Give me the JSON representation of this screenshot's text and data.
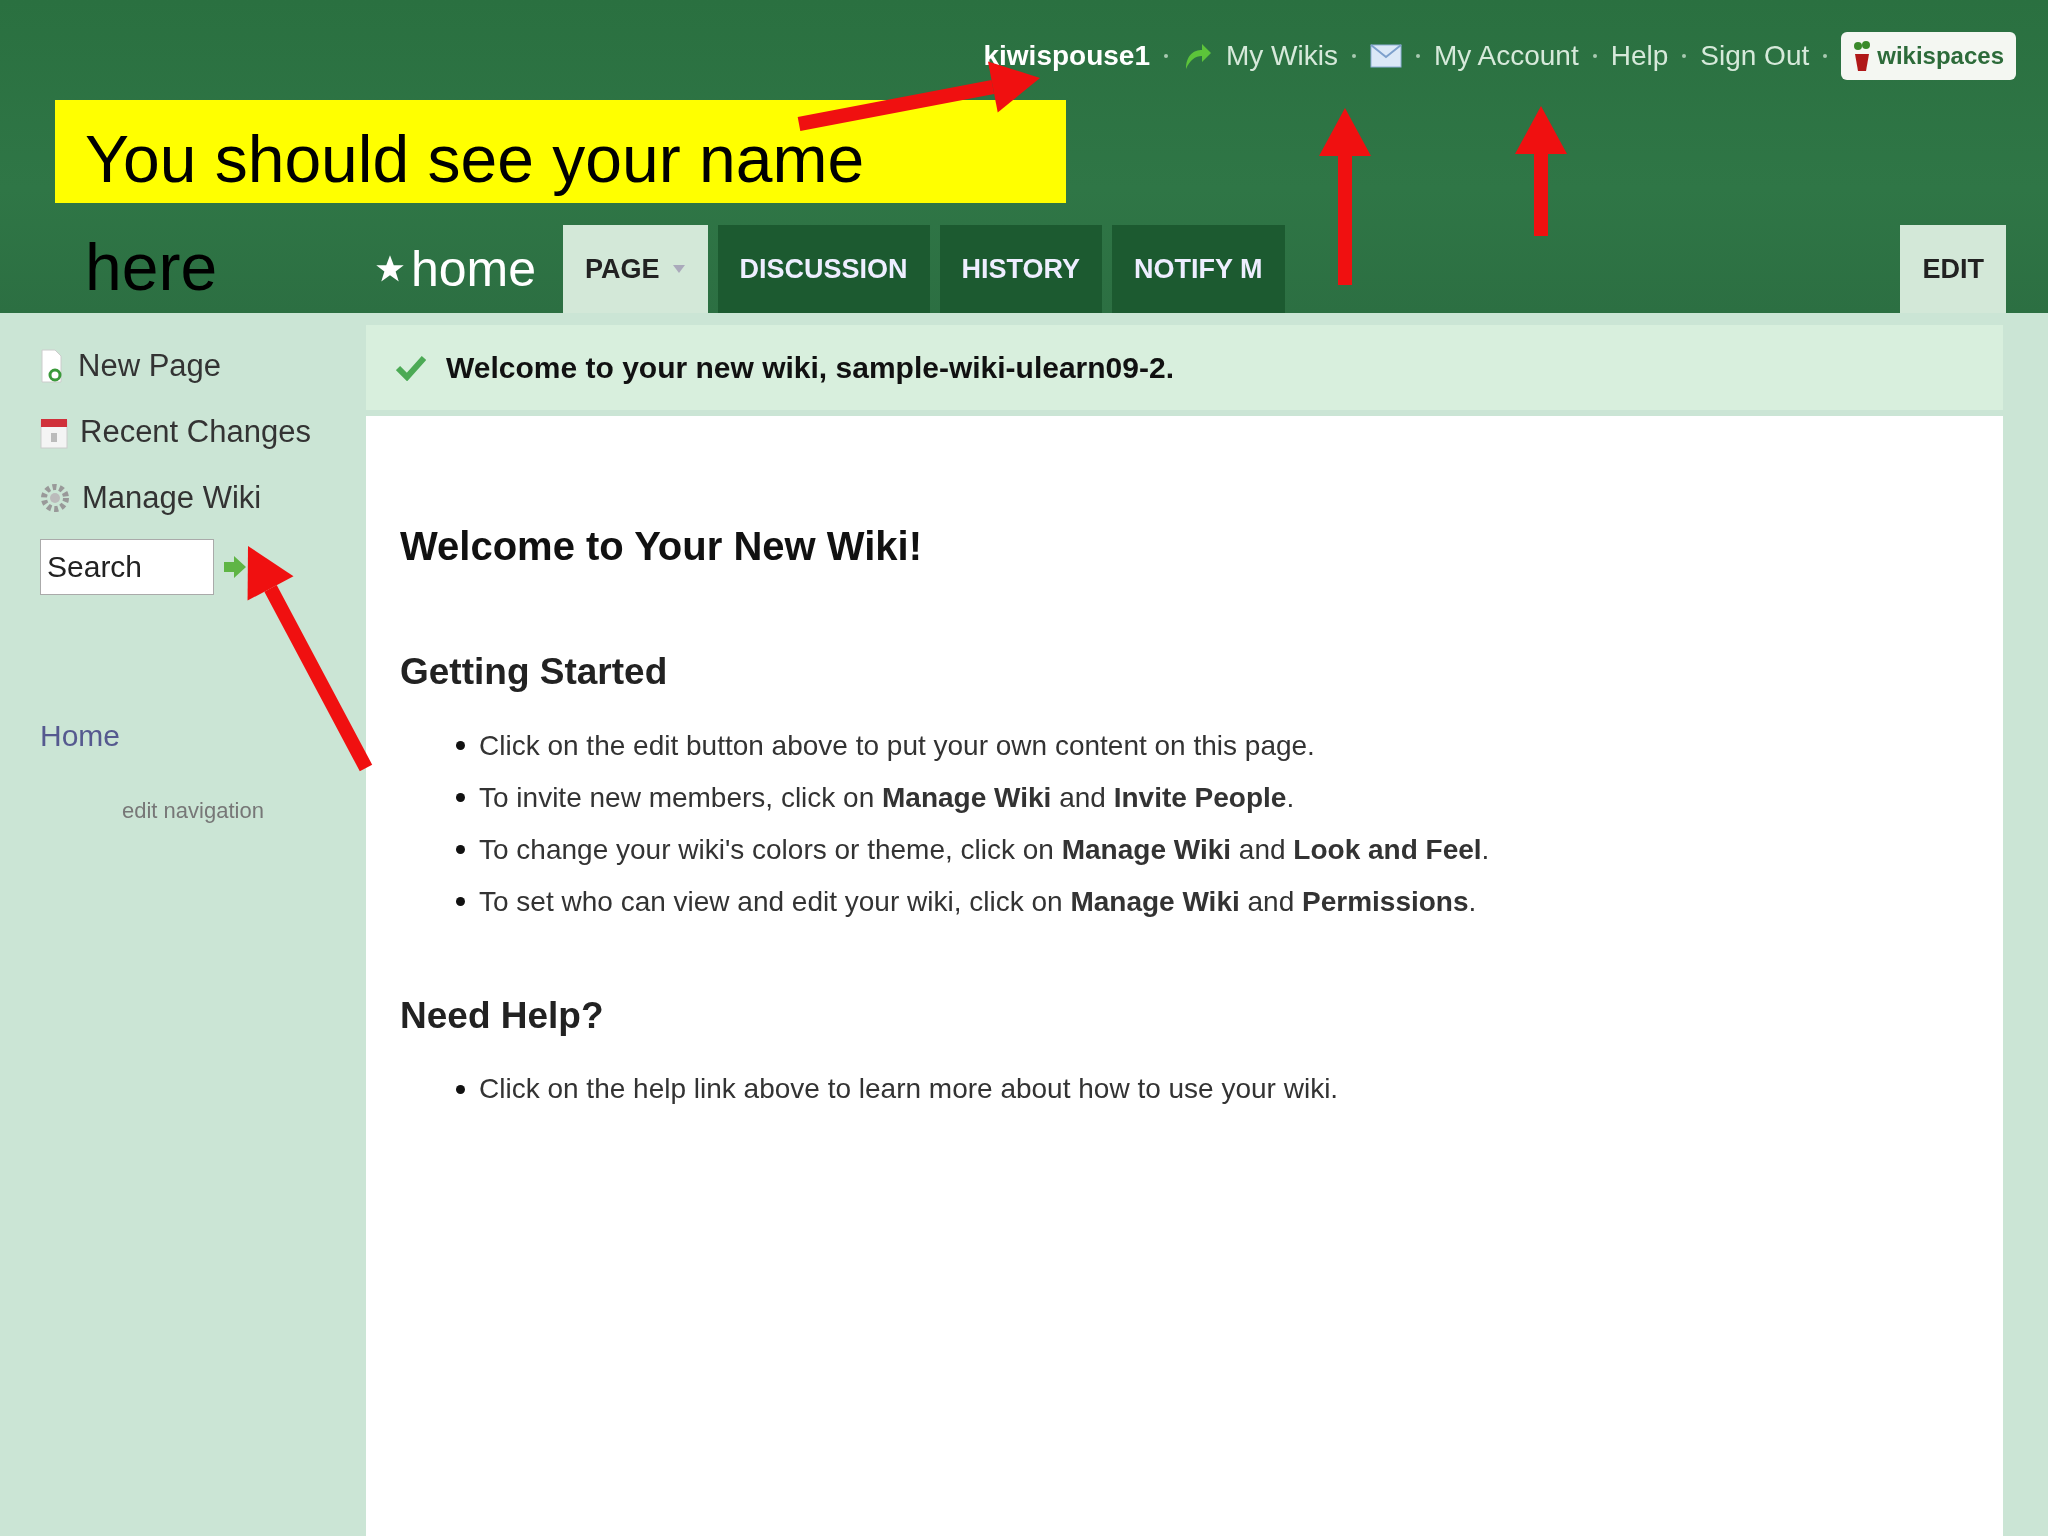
{
  "header": {
    "nav": [
      {
        "kind": "user",
        "label": "kiwispouse1"
      },
      {
        "kind": "shortcut",
        "label": "My Wikis"
      },
      {
        "kind": "mail"
      },
      {
        "kind": "link",
        "label": "My Account"
      },
      {
        "kind": "link",
        "label": "Help"
      },
      {
        "kind": "link",
        "label": "Sign Out"
      },
      {
        "kind": "logo",
        "label": "wikispaces"
      }
    ],
    "page_title": "home",
    "tabs": [
      {
        "label": "PAGE",
        "selected": true,
        "menu": true
      },
      {
        "label": "DISCUSSION",
        "selected": false,
        "menu": false
      },
      {
        "label": "HISTORY",
        "selected": false,
        "menu": false
      },
      {
        "label": "NOTIFY M",
        "selected": false,
        "menu": false
      }
    ],
    "edit_button": "EDIT"
  },
  "sidebar": {
    "items": [
      "New Page",
      "Recent Changes",
      "Manage Wiki"
    ],
    "search": {
      "value": "Search"
    },
    "nav_link": "Home",
    "edit_link": "edit navigation"
  },
  "banner": "Welcome to your new wiki, sample-wiki-ulearn09-2.",
  "content": {
    "title": "Welcome to Your New Wiki!",
    "sections": [
      {
        "heading": "Getting Started",
        "bullets": [
          "Click on the edit button above to put your own content on this page.",
          "To invite new members, click on **Manage Wiki** and **Invite People**.",
          "To change your wiki's colors or theme, click on **Manage Wiki** and **Look and Feel**.",
          "To set who can view and edit your wiki, click on **Manage Wiki** and **Permissions**."
        ]
      },
      {
        "heading": "Need Help?",
        "bullets": [
          "Click on the help link above to learn more about how to use your wiki."
        ]
      }
    ]
  },
  "callout": {
    "lines": [
      "You should see your name",
      "here"
    ]
  }
}
